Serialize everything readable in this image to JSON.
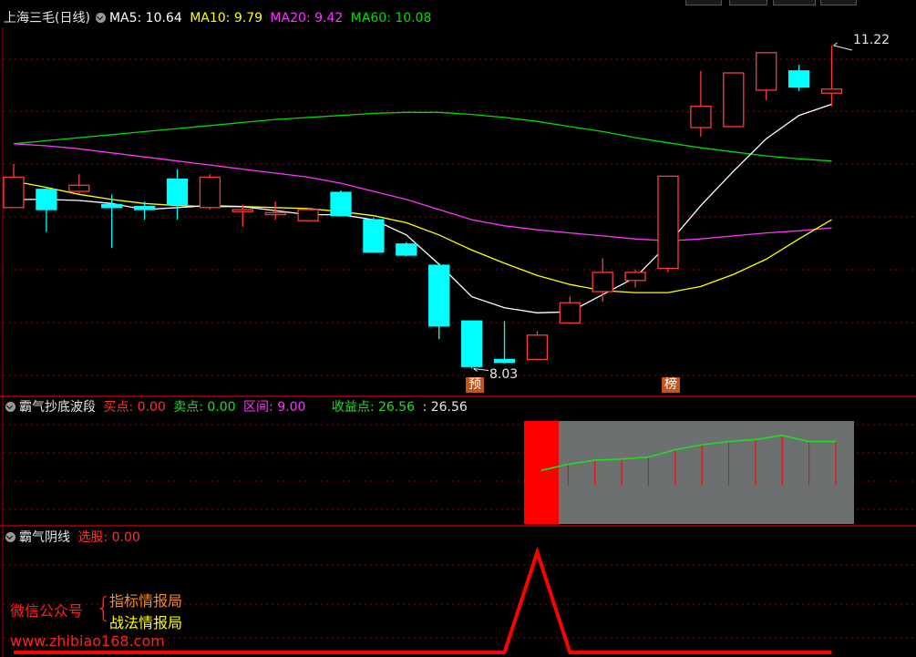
{
  "colors": {
    "bg": "#000000",
    "up": "#ff3a3a",
    "down": "#00ffff",
    "ma5": "#ffffff",
    "ma10": "#ffff00",
    "ma20": "#ff33ff",
    "ma60": "#00dd00",
    "grid": "#8b0000",
    "panel_border": "#b00000",
    "fill_red": "#ff0000",
    "fill_gray": "#6c7070",
    "green_line": "#22dd22"
  },
  "main": {
    "title": "上海三毛(日线)",
    "icon": "chevron-down-icon",
    "ma5_label": "MA5: 10.64",
    "ma10_label": "MA10: 9.79",
    "ma20_label": "MA20: 9.42",
    "ma60_label": "MA60: 10.08",
    "high_label": "11.22",
    "low_label": "8.03",
    "marker_yu": "预",
    "marker_bang": "榜"
  },
  "panel2": {
    "title": "霸气抄底波段",
    "buy_label": "买点: 0.00",
    "sell_label": "卖点: 0.00",
    "range_label": "区间: 9.00",
    "profit_label": "收益点: 26.56",
    "extra_label": ": 26.56"
  },
  "panel3": {
    "title": "霸气阴线",
    "select_label": "选股: 0.00"
  },
  "watermark": {
    "wechat": "微信公众号",
    "brace": "{",
    "item1": "指标情报局",
    "item2": "战法情报局",
    "site": "www.zhibiao168.com"
  },
  "chart_data": [
    {
      "type": "candlestick",
      "title": "上海三毛(日线)",
      "ylim": [
        7.8,
        11.4
      ],
      "candles": [
        {
          "o": 9.62,
          "c": 9.92,
          "h": 10.05,
          "l": 9.62
        },
        {
          "o": 9.8,
          "c": 9.6,
          "h": 9.82,
          "l": 9.38
        },
        {
          "o": 9.78,
          "c": 9.84,
          "h": 9.95,
          "l": 9.76
        },
        {
          "o": 9.65,
          "c": 9.62,
          "h": 9.75,
          "l": 9.22
        },
        {
          "o": 9.63,
          "c": 9.6,
          "h": 9.68,
          "l": 9.5
        },
        {
          "o": 9.9,
          "c": 9.65,
          "h": 10.0,
          "l": 9.5
        },
        {
          "o": 9.62,
          "c": 9.92,
          "h": 9.95,
          "l": 9.6
        },
        {
          "o": 9.58,
          "c": 9.6,
          "h": 9.65,
          "l": 9.43
        },
        {
          "o": 9.55,
          "c": 9.57,
          "h": 9.68,
          "l": 9.5
        },
        {
          "o": 9.49,
          "c": 9.6,
          "h": 9.62,
          "l": 9.48
        },
        {
          "o": 9.77,
          "c": 9.54,
          "h": 9.79,
          "l": 9.53
        },
        {
          "o": 9.5,
          "c": 9.18,
          "h": 9.52,
          "l": 9.18
        },
        {
          "o": 9.26,
          "c": 9.15,
          "h": 9.28,
          "l": 9.14
        },
        {
          "o": 9.05,
          "c": 8.45,
          "h": 9.05,
          "l": 8.32
        },
        {
          "o": 8.5,
          "c": 8.05,
          "h": 8.5,
          "l": 8.03
        },
        {
          "o": 8.12,
          "c": 8.09,
          "h": 8.5,
          "l": 8.08
        },
        {
          "o": 8.12,
          "c": 8.36,
          "h": 8.4,
          "l": 8.12
        },
        {
          "o": 8.48,
          "c": 8.68,
          "h": 8.74,
          "l": 8.47
        },
        {
          "o": 8.79,
          "c": 8.98,
          "h": 9.12,
          "l": 8.69
        },
        {
          "o": 8.9,
          "c": 8.98,
          "h": 9.01,
          "l": 8.83
        },
        {
          "o": 9.02,
          "c": 9.93,
          "h": 9.93,
          "l": 8.98
        },
        {
          "o": 10.41,
          "c": 10.62,
          "h": 10.97,
          "l": 10.32
        },
        {
          "o": 10.42,
          "c": 10.95,
          "h": 10.95,
          "l": 10.42
        },
        {
          "o": 10.78,
          "c": 11.15,
          "h": 11.15,
          "l": 10.68
        },
        {
          "o": 10.97,
          "c": 10.81,
          "h": 11.03,
          "l": 10.77
        },
        {
          "o": 10.75,
          "c": 10.79,
          "h": 11.22,
          "l": 10.62
        }
      ],
      "ma5": [
        9.7,
        9.7,
        9.69,
        9.66,
        9.6,
        9.62,
        9.64,
        9.63,
        9.59,
        9.55,
        9.55,
        9.5,
        9.35,
        9.06,
        8.74,
        8.63,
        8.58,
        8.59,
        8.76,
        8.93,
        9.26,
        9.64,
        9.98,
        10.3,
        10.53,
        10.64
      ],
      "ma10": [
        9.88,
        9.82,
        9.75,
        9.7,
        9.66,
        9.64,
        9.63,
        9.63,
        9.62,
        9.61,
        9.58,
        9.54,
        9.47,
        9.35,
        9.2,
        9.07,
        8.95,
        8.86,
        8.8,
        8.78,
        8.78,
        8.84,
        8.96,
        9.11,
        9.31,
        9.5
      ],
      "ma20": [
        10.25,
        10.23,
        10.2,
        10.16,
        10.12,
        10.08,
        10.04,
        10.0,
        9.96,
        9.92,
        9.86,
        9.78,
        9.7,
        9.6,
        9.5,
        9.44,
        9.4,
        9.37,
        9.34,
        9.31,
        9.29,
        9.31,
        9.34,
        9.37,
        9.39,
        9.42
      ],
      "ma60": [
        10.25,
        10.28,
        10.31,
        10.34,
        10.37,
        10.4,
        10.43,
        10.46,
        10.49,
        10.51,
        10.53,
        10.55,
        10.56,
        10.56,
        10.54,
        10.51,
        10.47,
        10.42,
        10.37,
        10.31,
        10.26,
        10.21,
        10.17,
        10.13,
        10.1,
        10.08
      ]
    },
    {
      "type": "line",
      "title": "霸气抄底波段",
      "series": [
        {
          "values": [
            0.52,
            0.58,
            0.62,
            0.63,
            0.65,
            0.72,
            0.77,
            0.8,
            0.82,
            0.86,
            0.8,
            0.8
          ]
        }
      ]
    },
    {
      "type": "line",
      "title": "霸气阴线",
      "series": [
        {
          "values": [
            0,
            0,
            0,
            0,
            0,
            0,
            0,
            0,
            0,
            0,
            0,
            0,
            0,
            0,
            0,
            0,
            1,
            0,
            0,
            0,
            0,
            0,
            0,
            0,
            0,
            0
          ]
        }
      ]
    }
  ]
}
